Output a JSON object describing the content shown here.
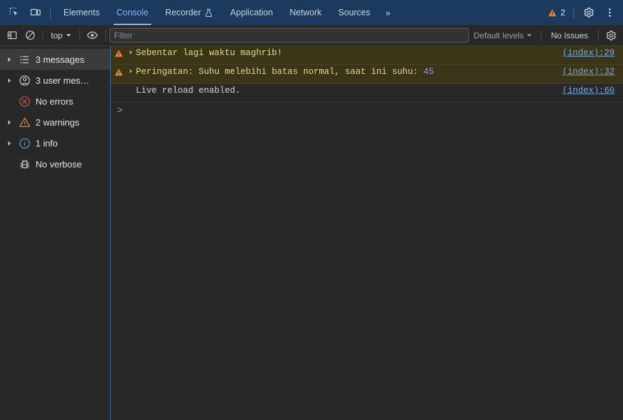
{
  "tabbar": {
    "icons": [
      {
        "name": "inspect-element-icon",
        "title": "Inspect element"
      },
      {
        "name": "device-toolbar-icon",
        "title": "Toggle device toolbar"
      }
    ],
    "tabs": [
      {
        "label": "Elements",
        "active": false,
        "experiment": false
      },
      {
        "label": "Console",
        "active": true,
        "experiment": false
      },
      {
        "label": "Recorder",
        "active": false,
        "experiment": true
      },
      {
        "label": "Application",
        "active": false,
        "experiment": false
      },
      {
        "label": "Network",
        "active": false,
        "experiment": false
      },
      {
        "label": "Sources",
        "active": false,
        "experiment": false
      }
    ],
    "more_label": "»",
    "warning_count": "2",
    "settings_icon": "gear-icon",
    "more_options_icon": "kebab-menu-icon",
    "accent_color": "#8ab4f8",
    "background_color": "#1c3a5e"
  },
  "filterbar": {
    "sidebar_toggle_icon": "console-sidebar-toggle-icon",
    "clear_console_icon": "clear-console-icon",
    "context_label": "top",
    "eye_icon": "live-expression-eye-icon",
    "filter_placeholder": "Filter",
    "filter_value": "",
    "levels_label": "Default levels",
    "issues_label": "No Issues",
    "settings_icon": "console-settings-gear-icon"
  },
  "sidebar": {
    "items": [
      {
        "label": "3 messages",
        "icon": "list-icon",
        "expandable": true,
        "selected": true
      },
      {
        "label": "3 user mes…",
        "icon": "user-icon",
        "expandable": true,
        "selected": false
      },
      {
        "label": "No errors",
        "icon": "error-circle-icon",
        "expandable": false,
        "selected": false
      },
      {
        "label": "2 warnings",
        "icon": "warning-triangle-icon",
        "expandable": true,
        "selected": false
      },
      {
        "label": "1 info",
        "icon": "info-circle-icon",
        "expandable": true,
        "selected": false
      },
      {
        "label": "No verbose",
        "icon": "bug-icon",
        "expandable": false,
        "selected": false
      }
    ]
  },
  "console": {
    "messages": [
      {
        "level": "warning",
        "icon": "warning-triangle-icon",
        "expandable": true,
        "text": "Sebentar lagi waktu maghrib!",
        "value": "",
        "source": "(index):29"
      },
      {
        "level": "warning",
        "icon": "warning-triangle-icon",
        "expandable": true,
        "text": "Peringatan: Suhu melebihi batas normal, saat ini suhu: ",
        "value": "45",
        "source": "(index):32"
      },
      {
        "level": "info",
        "icon": "",
        "expandable": false,
        "text": "Live reload enabled.",
        "value": "",
        "source": "(index):60"
      }
    ],
    "prompt_symbol": ">",
    "prompt_value": "",
    "warning_bg_color": "#3a3418",
    "warning_text_color": "#e8d98b",
    "number_literal_color": "#a98eff",
    "source_link_color": "#7aa9dd"
  }
}
